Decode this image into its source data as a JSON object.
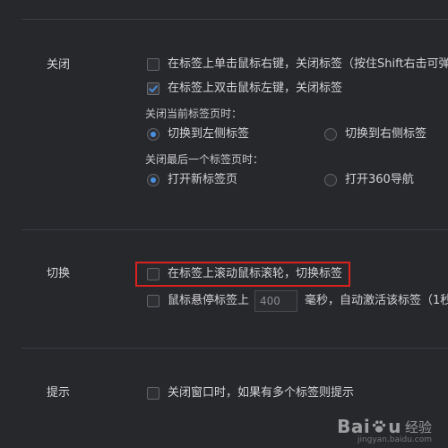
{
  "close_section": {
    "label": "关闭",
    "right_click_close": {
      "label": "在标签上单击鼠标右键，关闭标签（按住Shift右击可弹",
      "checked": false
    },
    "double_click_close": {
      "label": "在标签上双击鼠标左键，关闭标签",
      "checked": true
    },
    "on_close_current_heading": "关闭当前标签页时：",
    "switch_left": {
      "label": "切换到左侧标签",
      "selected": true
    },
    "switch_right": {
      "label": "切换到右侧标签",
      "selected": false
    },
    "on_close_last_heading": "关闭最后一个标签页时：",
    "open_new_tab": {
      "label": "打开新标签页",
      "selected": true
    },
    "open_360_nav": {
      "label": "打开360导航",
      "selected": false
    }
  },
  "switch_section": {
    "label": "切换",
    "scroll_switch": {
      "label": "在标签上滚动鼠标滚轮，切换标签",
      "checked": false
    },
    "hover_activate": {
      "label_before": "鼠标悬停标签上",
      "input_value": "400",
      "label_after": "毫秒，自动激活该标签（1秒",
      "checked": false
    }
  },
  "hint_section": {
    "label": "提示",
    "close_window_prompt": {
      "label": "关闭窗口时，如果有多个标签则提示",
      "checked": false
    }
  },
  "watermark": {
    "brand": "Bai",
    "brand_suffix": "u",
    "jingyan": "经验",
    "url": "jingyan.baidu.com"
  },
  "colors": {
    "background": "#27282c",
    "accent": "#4a90e2",
    "highlight": "#d9211e"
  }
}
